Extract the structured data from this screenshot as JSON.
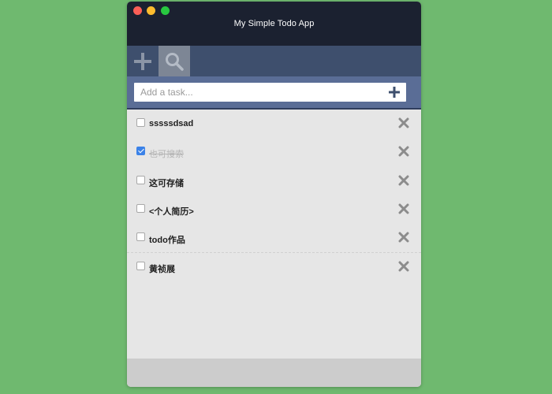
{
  "window": {
    "title": "My Simple Todo App"
  },
  "toolbar": {
    "add_icon": "plus-icon",
    "search_icon": "magnifier-icon"
  },
  "input": {
    "placeholder": "Add a task...",
    "value": ""
  },
  "tasks": [
    {
      "label": "sssssdsad",
      "done": false
    },
    {
      "label": "也可搜索",
      "done": true
    },
    {
      "label": "这可存储",
      "done": false
    },
    {
      "label": "<个人简历>",
      "done": false
    },
    {
      "label": "todo作品",
      "done": false
    },
    {
      "label": "黄祯展",
      "done": false
    }
  ],
  "colors": {
    "background": "#6fb96f",
    "titlebar": "#1b2130",
    "toolbar": "#3e4f6d",
    "input_area": "#5a6d96",
    "checkbox_checked": "#3b82e8"
  }
}
